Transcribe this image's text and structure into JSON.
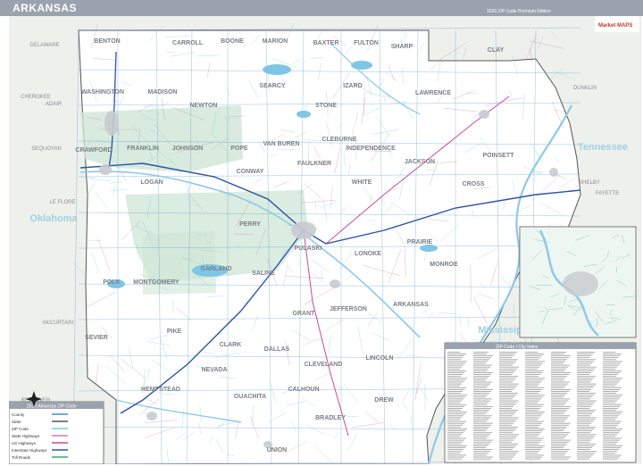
{
  "header": {
    "title": "ARKANSAS",
    "edition": "2020 ZIP Code Premium Edition"
  },
  "colors": {
    "title_bar": "#9aa3ad",
    "land": "#ffffff",
    "outside_state": "#eef0ec",
    "forest": "#cfe6d6",
    "water": "#7fc6e6",
    "river": "#8ec9e8",
    "county_line": "#3a8fd0",
    "zip_line": "#7fd0c8",
    "interstate": "#2b52a8",
    "us_highway": "#c64a9a",
    "state_highway": "#d07ab8",
    "city": "#c8cbd0"
  },
  "counties": [
    "BENTON",
    "CARROLL",
    "BOONE",
    "MARION",
    "BAXTER",
    "FULTON",
    "SHARP",
    "CLAY",
    "WASHINGTON",
    "MADISON",
    "NEWTON",
    "SEARCY",
    "IZARD",
    "STONE",
    "LAWRENCE",
    "CRAWFORD",
    "FRANKLIN",
    "JOHNSON",
    "POPE",
    "VAN BUREN",
    "CLEBURNE",
    "INDEPENDENCE",
    "LOGAN",
    "CONWAY",
    "FAULKNER",
    "WHITE",
    "JACKSON",
    "POINSETT",
    "CROSS",
    "PERRY",
    "PULASKI",
    "LONOKE",
    "PRAIRIE",
    "MONROE",
    "POLK",
    "MONTGOMERY",
    "GARLAND",
    "SALINE",
    "GRANT",
    "JEFFERSON",
    "ARKANSAS",
    "SEVIER",
    "PIKE",
    "CLARK",
    "DALLAS",
    "CLEVELAND",
    "LINCOLN",
    "HEMPSTEAD",
    "NEVADA",
    "OUACHITA",
    "CALHOUN",
    "BRADLEY",
    "DREW",
    "UNION"
  ],
  "neighbor_labels": [
    "DELAWARE",
    "CHEROKEE",
    "ADAIR",
    "SEQUOYAH",
    "LE FLORE",
    "McCURTAIN",
    "Oklahoma",
    "RED RIVER",
    "Mississippi",
    "Tennessee",
    "DUNKLIN",
    "SHELBY",
    "FAYETTE",
    "DESOTO",
    "TATE"
  ],
  "legend": {
    "title": "2020 Arkansas ZIP Code",
    "items": [
      {
        "label": "County",
        "color": "#3a8fd0"
      },
      {
        "label": "State",
        "color": "#555555"
      },
      {
        "label": "ZIP Code",
        "color": "#7fd0c8"
      },
      {
        "label": "State Highways",
        "color": "#d07ab8"
      },
      {
        "label": "US Highways",
        "color": "#c64a9a"
      },
      {
        "label": "Interstate Highways",
        "color": "#2b52a8"
      },
      {
        "label": "Toll Roads",
        "color": "#3aa86a"
      }
    ]
  },
  "index_title": "ZIP Code / City Index",
  "brand": "Market MAPS"
}
